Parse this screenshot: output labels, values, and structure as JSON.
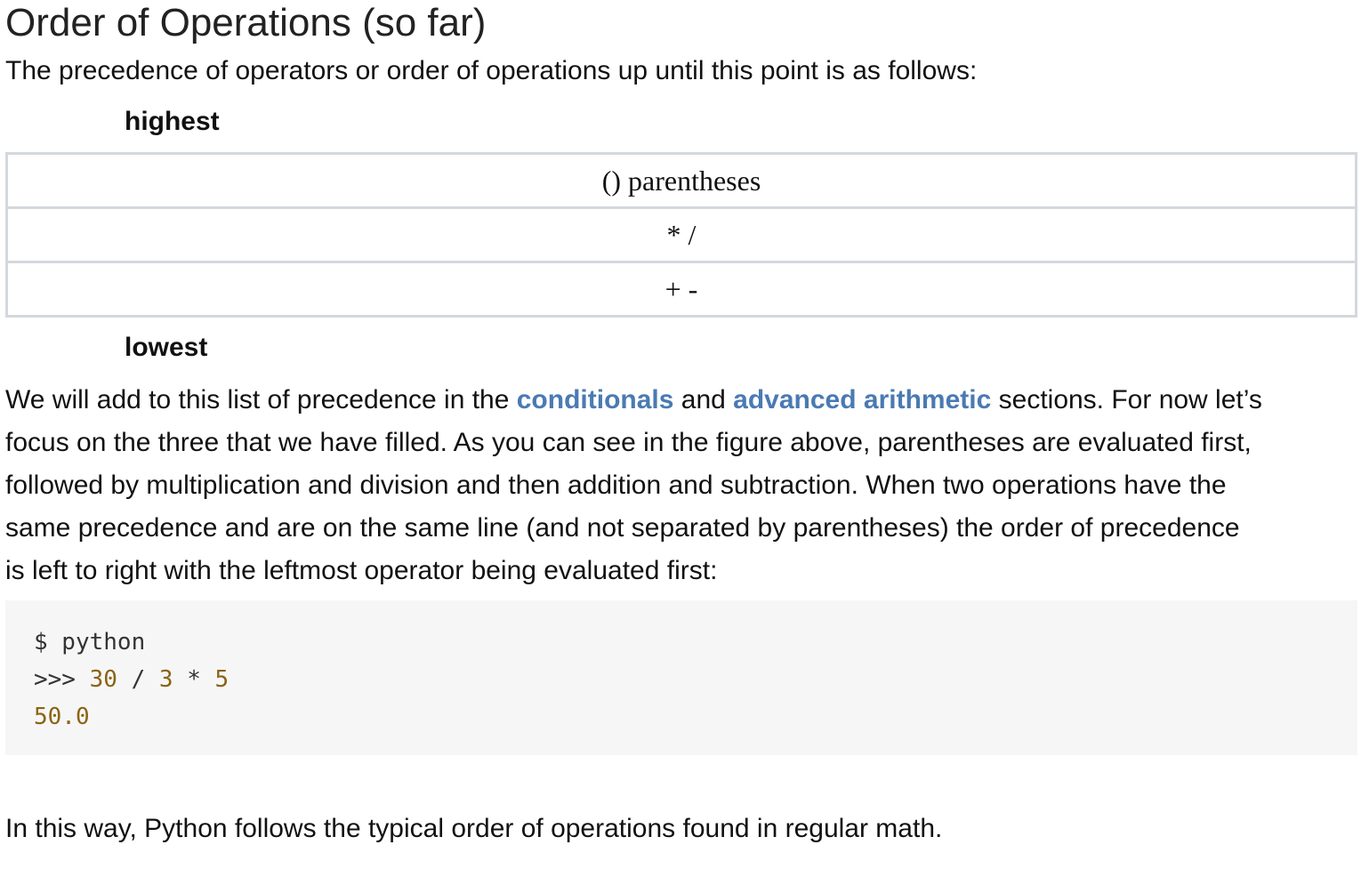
{
  "heading": "Order of Operations (so far)",
  "intro": "The precedence of operators or order of operations up until this point is as follows:",
  "precedence": {
    "highest_label": "highest",
    "lowest_label": "lowest",
    "rows": [
      "() parentheses",
      "* /",
      "+ -"
    ]
  },
  "paragraph": {
    "part1": "We will add to this list of precedence in the ",
    "link1": "conditionals",
    "part2": " and ",
    "link2": "advanced arithmetic",
    "part3": " sections. For now let’s",
    "line2": "focus on the three that we have filled. As you can see in the figure above, parentheses are evaluated first,",
    "line3": "followed by multiplication and division and then addition and subtraction. When two operations have the",
    "line4": "same precedence and are on the same line (and not separated by parentheses) the order of precedence",
    "line5": "is left to right with the leftmost operator being evaluated first:"
  },
  "code": {
    "line1": "$ python",
    "prompt": ">>> ",
    "num1": "30",
    "op1": " / ",
    "num2": "3",
    "op2": " * ",
    "num3": "5",
    "result": "50.0"
  },
  "closing": "In this way, Python follows the typical order of operations found in regular math."
}
